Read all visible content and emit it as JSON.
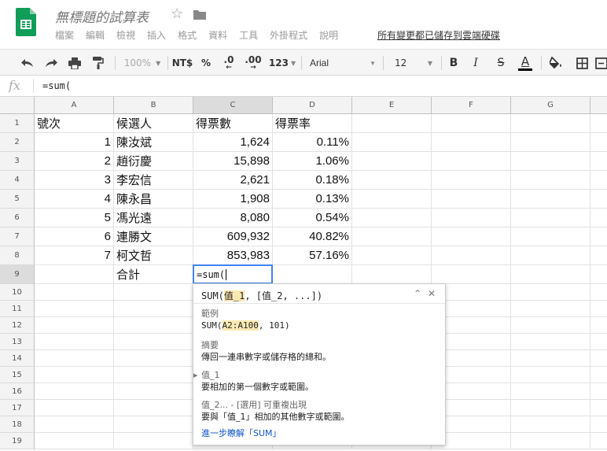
{
  "app": {
    "title": "無標題的試算表",
    "menu": [
      "檔案",
      "編輯",
      "檢視",
      "插入",
      "格式",
      "資料",
      "工具",
      "外掛程式",
      "說明"
    ],
    "save_status": "所有變更都已儲存到雲端硬碟"
  },
  "toolbar": {
    "zoom": "100%",
    "currency": "NT$",
    "percent": "%",
    "decrease_decimal": ".0",
    "increase_decimal": ".00",
    "more_formats": "123",
    "font": "Arial",
    "font_size": "12",
    "bold": "B",
    "italic": "I",
    "strike": "S",
    "text_color_letter": "A"
  },
  "formula_bar": {
    "fx": "fx",
    "value": "=sum("
  },
  "columns": [
    "A",
    "B",
    "C",
    "D",
    "E",
    "F",
    "G"
  ],
  "rows": [
    "1",
    "2",
    "3",
    "4",
    "5",
    "6",
    "7",
    "8",
    "9",
    "10",
    "11",
    "12",
    "13",
    "14",
    "15",
    "16",
    "17",
    "18",
    "19"
  ],
  "sheet": {
    "r1": {
      "a": "號次",
      "b": "候選人",
      "c": "得票數",
      "d": "得票率"
    },
    "r2": {
      "a": "1",
      "b": "陳汝斌",
      "c": "1,624",
      "d": "0.11%"
    },
    "r3": {
      "a": "2",
      "b": "趙衍慶",
      "c": "15,898",
      "d": "1.06%"
    },
    "r4": {
      "a": "3",
      "b": "李宏信",
      "c": "2,621",
      "d": "0.18%"
    },
    "r5": {
      "a": "4",
      "b": "陳永昌",
      "c": "1,908",
      "d": "0.13%"
    },
    "r6": {
      "a": "5",
      "b": "馮光遠",
      "c": "8,080",
      "d": "0.54%"
    },
    "r7": {
      "a": "6",
      "b": "連勝文",
      "c": "609,932",
      "d": "40.82%"
    },
    "r8": {
      "a": "7",
      "b": "柯文哲",
      "c": "853,983",
      "d": "57.16%"
    },
    "r9": {
      "b": "合計",
      "c": "=sum("
    }
  },
  "help": {
    "sig_prefix": "SUM(",
    "sig_arg1": "值_1",
    "sig_rest": ", [值_2, ...])",
    "example_title": "範例",
    "example_prefix": "SUM(",
    "example_arg": "A2:A100",
    "example_rest": ", 101)",
    "summary_title": "摘要",
    "summary_text": "傳回一連串數字或儲存格的總和。",
    "arg1_name": "值_1",
    "arg1_desc": "要相加的第一個數字或範圍。",
    "arg2_name": "值_2... - [選用] 可重複出現",
    "arg2_desc": "要與「值_1」相加的其他數字或範圍。",
    "learn_more": "進一步瞭解「SUM」"
  }
}
